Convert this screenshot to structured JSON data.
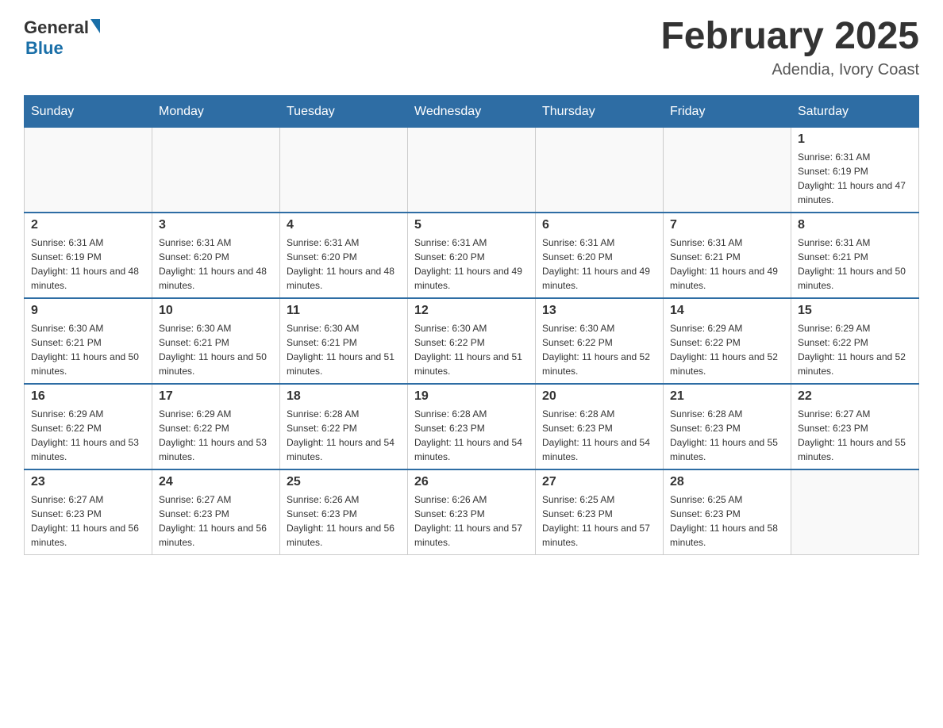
{
  "logo": {
    "general": "General",
    "blue": "Blue"
  },
  "title": {
    "month_year": "February 2025",
    "location": "Adendia, Ivory Coast"
  },
  "days_of_week": [
    "Sunday",
    "Monday",
    "Tuesday",
    "Wednesday",
    "Thursday",
    "Friday",
    "Saturday"
  ],
  "weeks": [
    [
      {
        "day": "",
        "info": ""
      },
      {
        "day": "",
        "info": ""
      },
      {
        "day": "",
        "info": ""
      },
      {
        "day": "",
        "info": ""
      },
      {
        "day": "",
        "info": ""
      },
      {
        "day": "",
        "info": ""
      },
      {
        "day": "1",
        "info": "Sunrise: 6:31 AM\nSunset: 6:19 PM\nDaylight: 11 hours and 47 minutes."
      }
    ],
    [
      {
        "day": "2",
        "info": "Sunrise: 6:31 AM\nSunset: 6:19 PM\nDaylight: 11 hours and 48 minutes."
      },
      {
        "day": "3",
        "info": "Sunrise: 6:31 AM\nSunset: 6:20 PM\nDaylight: 11 hours and 48 minutes."
      },
      {
        "day": "4",
        "info": "Sunrise: 6:31 AM\nSunset: 6:20 PM\nDaylight: 11 hours and 48 minutes."
      },
      {
        "day": "5",
        "info": "Sunrise: 6:31 AM\nSunset: 6:20 PM\nDaylight: 11 hours and 49 minutes."
      },
      {
        "day": "6",
        "info": "Sunrise: 6:31 AM\nSunset: 6:20 PM\nDaylight: 11 hours and 49 minutes."
      },
      {
        "day": "7",
        "info": "Sunrise: 6:31 AM\nSunset: 6:21 PM\nDaylight: 11 hours and 49 minutes."
      },
      {
        "day": "8",
        "info": "Sunrise: 6:31 AM\nSunset: 6:21 PM\nDaylight: 11 hours and 50 minutes."
      }
    ],
    [
      {
        "day": "9",
        "info": "Sunrise: 6:30 AM\nSunset: 6:21 PM\nDaylight: 11 hours and 50 minutes."
      },
      {
        "day": "10",
        "info": "Sunrise: 6:30 AM\nSunset: 6:21 PM\nDaylight: 11 hours and 50 minutes."
      },
      {
        "day": "11",
        "info": "Sunrise: 6:30 AM\nSunset: 6:21 PM\nDaylight: 11 hours and 51 minutes."
      },
      {
        "day": "12",
        "info": "Sunrise: 6:30 AM\nSunset: 6:22 PM\nDaylight: 11 hours and 51 minutes."
      },
      {
        "day": "13",
        "info": "Sunrise: 6:30 AM\nSunset: 6:22 PM\nDaylight: 11 hours and 52 minutes."
      },
      {
        "day": "14",
        "info": "Sunrise: 6:29 AM\nSunset: 6:22 PM\nDaylight: 11 hours and 52 minutes."
      },
      {
        "day": "15",
        "info": "Sunrise: 6:29 AM\nSunset: 6:22 PM\nDaylight: 11 hours and 52 minutes."
      }
    ],
    [
      {
        "day": "16",
        "info": "Sunrise: 6:29 AM\nSunset: 6:22 PM\nDaylight: 11 hours and 53 minutes."
      },
      {
        "day": "17",
        "info": "Sunrise: 6:29 AM\nSunset: 6:22 PM\nDaylight: 11 hours and 53 minutes."
      },
      {
        "day": "18",
        "info": "Sunrise: 6:28 AM\nSunset: 6:22 PM\nDaylight: 11 hours and 54 minutes."
      },
      {
        "day": "19",
        "info": "Sunrise: 6:28 AM\nSunset: 6:23 PM\nDaylight: 11 hours and 54 minutes."
      },
      {
        "day": "20",
        "info": "Sunrise: 6:28 AM\nSunset: 6:23 PM\nDaylight: 11 hours and 54 minutes."
      },
      {
        "day": "21",
        "info": "Sunrise: 6:28 AM\nSunset: 6:23 PM\nDaylight: 11 hours and 55 minutes."
      },
      {
        "day": "22",
        "info": "Sunrise: 6:27 AM\nSunset: 6:23 PM\nDaylight: 11 hours and 55 minutes."
      }
    ],
    [
      {
        "day": "23",
        "info": "Sunrise: 6:27 AM\nSunset: 6:23 PM\nDaylight: 11 hours and 56 minutes."
      },
      {
        "day": "24",
        "info": "Sunrise: 6:27 AM\nSunset: 6:23 PM\nDaylight: 11 hours and 56 minutes."
      },
      {
        "day": "25",
        "info": "Sunrise: 6:26 AM\nSunset: 6:23 PM\nDaylight: 11 hours and 56 minutes."
      },
      {
        "day": "26",
        "info": "Sunrise: 6:26 AM\nSunset: 6:23 PM\nDaylight: 11 hours and 57 minutes."
      },
      {
        "day": "27",
        "info": "Sunrise: 6:25 AM\nSunset: 6:23 PM\nDaylight: 11 hours and 57 minutes."
      },
      {
        "day": "28",
        "info": "Sunrise: 6:25 AM\nSunset: 6:23 PM\nDaylight: 11 hours and 58 minutes."
      },
      {
        "day": "",
        "info": ""
      }
    ]
  ]
}
